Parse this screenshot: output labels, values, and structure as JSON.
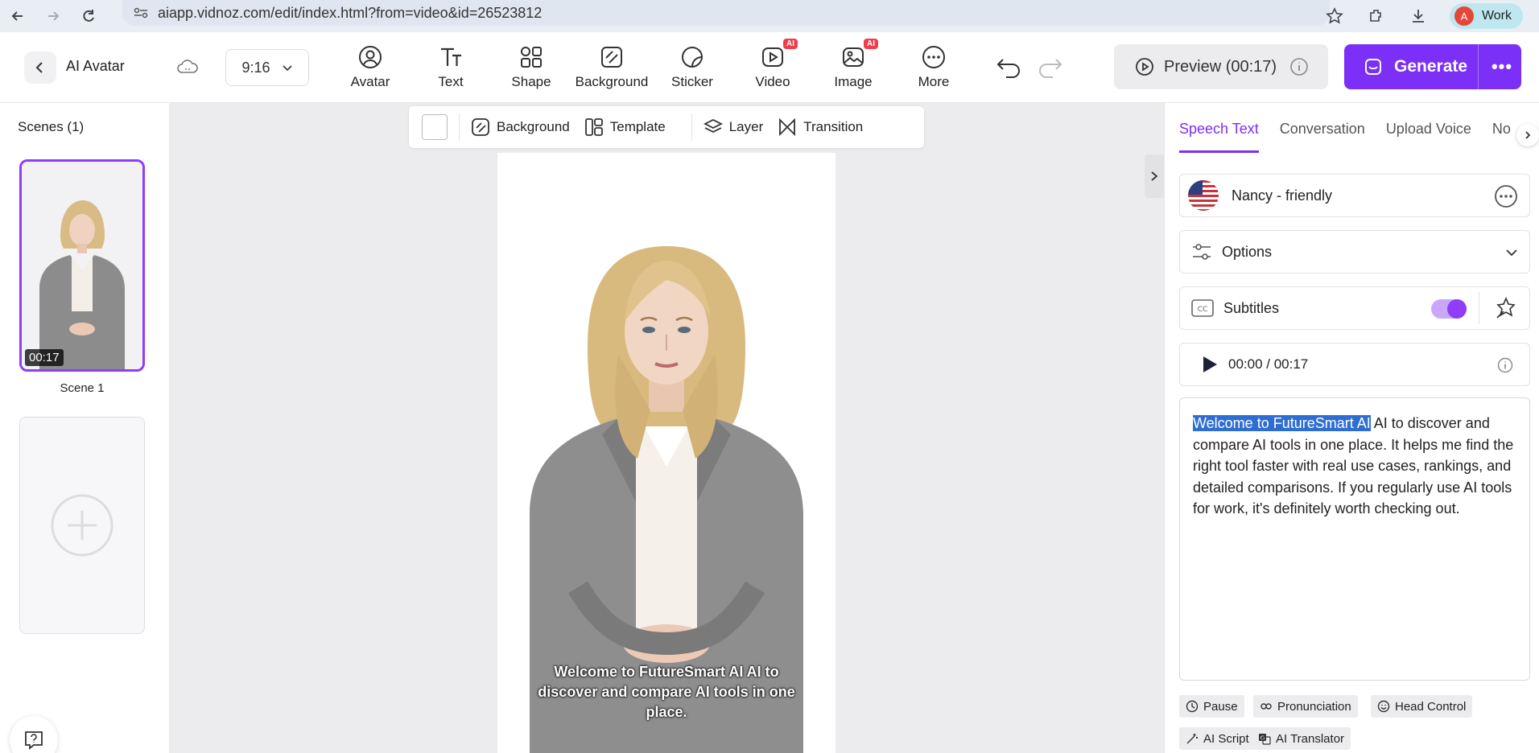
{
  "browser": {
    "url": "aiapp.vidnoz.com/edit/index.html?from=video&id=26523812",
    "profile_initial": "A",
    "profile_name": "Work"
  },
  "toolbar": {
    "title": "AI Avatar",
    "aspect_ratio": "9:16",
    "tools": [
      {
        "label": "Avatar",
        "icon": "avatar-icon"
      },
      {
        "label": "Text",
        "icon": "text-icon"
      },
      {
        "label": "Shape",
        "icon": "shape-icon"
      },
      {
        "label": "Background",
        "icon": "background-icon"
      },
      {
        "label": "Sticker",
        "icon": "sticker-icon"
      },
      {
        "label": "Video",
        "icon": "video-icon",
        "badge": "AI"
      },
      {
        "label": "Image",
        "icon": "image-icon",
        "badge": "AI"
      },
      {
        "label": "More",
        "icon": "more-icon"
      }
    ],
    "preview_label": "Preview (00:17)",
    "generate_label": "Generate",
    "generate_more": "•••"
  },
  "scenes": {
    "title": "Scenes (1)",
    "items": [
      {
        "label": "Scene 1",
        "duration": "00:17"
      }
    ]
  },
  "canvas_toolbar": {
    "background_label": "Background",
    "template_label": "Template",
    "layer_label": "Layer",
    "transition_label": "Transition"
  },
  "canvas": {
    "subtitle": "Welcome to FutureSmart AI AI to discover and compare AI tools in one place."
  },
  "right_panel": {
    "tabs": [
      "Speech Text",
      "Conversation",
      "Upload Voice",
      "No"
    ],
    "active_tab": "Speech Text",
    "voice_name": "Nancy - friendly",
    "options_label": "Options",
    "subtitles_label": "Subtitles",
    "subtitles_on": true,
    "player_time": "00:00 / 00:17",
    "script_highlight": "Welcome to FutureSmart AI",
    "script_rest": " AI to discover and compare AI tools in one place. It helps me find the right tool faster with real use cases, rankings, and detailed comparisons. If you regularly use AI tools for work, it's definitely worth checking out.",
    "chips": [
      "Pause",
      "Pronunciation",
      "Head Control",
      "AI Script",
      "AI Translator"
    ]
  },
  "colors": {
    "accent": "#7b2ff7",
    "ai_badge": "#ef3d4c",
    "highlight": "#2f6ed1"
  }
}
